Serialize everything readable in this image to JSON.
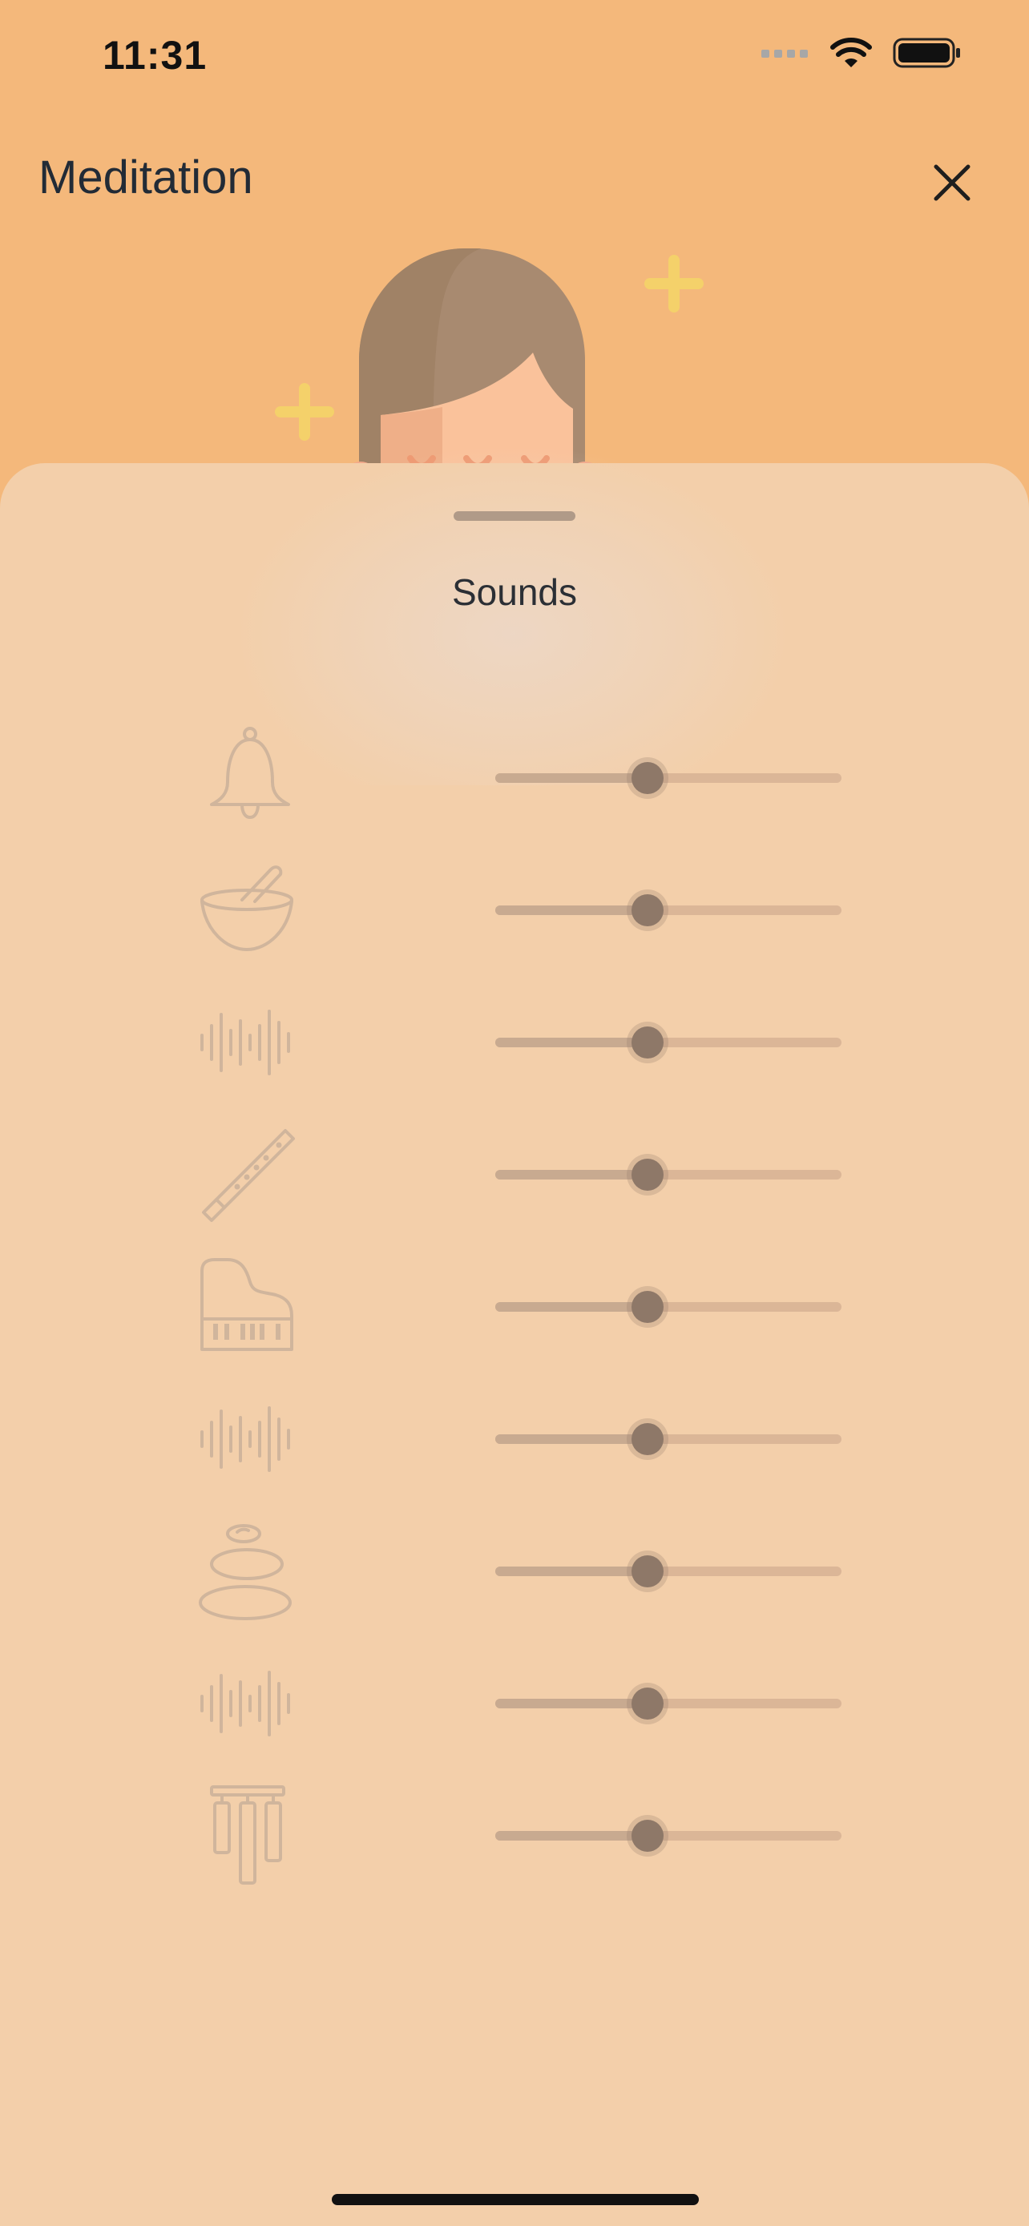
{
  "status_bar": {
    "time": "11:31"
  },
  "header": {
    "title": "Meditation"
  },
  "sheet": {
    "title": "Sounds",
    "rows": [
      {
        "icon": "bell-icon",
        "value": 0.44
      },
      {
        "icon": "singing-bowl-icon",
        "value": 0.44
      },
      {
        "icon": "waveform-icon",
        "value": 0.44
      },
      {
        "icon": "flute-icon",
        "value": 0.44
      },
      {
        "icon": "piano-icon",
        "value": 0.44
      },
      {
        "icon": "waveform-icon",
        "value": 0.44
      },
      {
        "icon": "stones-icon",
        "value": 0.44
      },
      {
        "icon": "waveform-icon",
        "value": 0.44
      },
      {
        "icon": "wind-chimes-icon",
        "value": 0.44
      }
    ]
  },
  "colors": {
    "background": "#F4B87B",
    "sheet": "#F3CFAA",
    "icon": "#D0B59C",
    "thumb": "#8E7868",
    "hair": "#A88A70",
    "face": "#FAC29B",
    "sparkle": "#F4D16A"
  }
}
